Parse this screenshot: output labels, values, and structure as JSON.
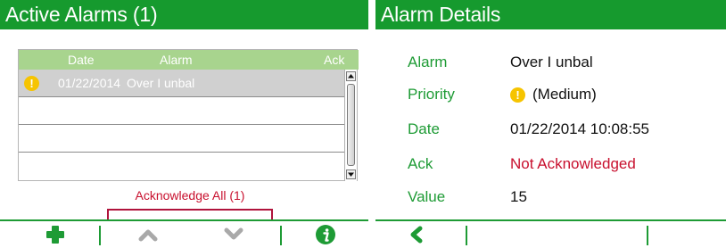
{
  "left_panel": {
    "title": "Active Alarms  (1)",
    "columns": {
      "date": "Date",
      "alarm": "Alarm",
      "ack": "Ack"
    },
    "rows": [
      {
        "date": "01/22/2014",
        "alarm": "Over I unbal",
        "priority_icon": "exclamation-circle-icon"
      },
      {
        "date": "",
        "alarm": ""
      },
      {
        "date": "",
        "alarm": ""
      },
      {
        "date": "",
        "alarm": ""
      }
    ],
    "acknowledge_all_label": "Acknowledge All  (1)",
    "toolbar": {
      "buttons": [
        "plus-icon",
        "chevron-up-icon",
        "chevron-down-icon",
        "info-icon"
      ]
    }
  },
  "right_panel": {
    "title": "Alarm Details",
    "details": [
      {
        "label": "Alarm",
        "value": "Over I unbal"
      },
      {
        "label": "Priority",
        "value": "(Medium)"
      },
      {
        "label": "Date",
        "value": "01/22/2014 10:08:55"
      },
      {
        "label": "Ack",
        "value": "Not Acknowledged"
      },
      {
        "label": "Value",
        "value": "15"
      }
    ],
    "toolbar": {
      "buttons": [
        "back-arrow-icon"
      ]
    }
  },
  "colors": {
    "brand_green": "#169a2e",
    "header_green_light": "#a8d48e",
    "alert_red": "#c8102e",
    "priority_yellow": "#f6c400",
    "selected_row": "#d0d0d0"
  }
}
